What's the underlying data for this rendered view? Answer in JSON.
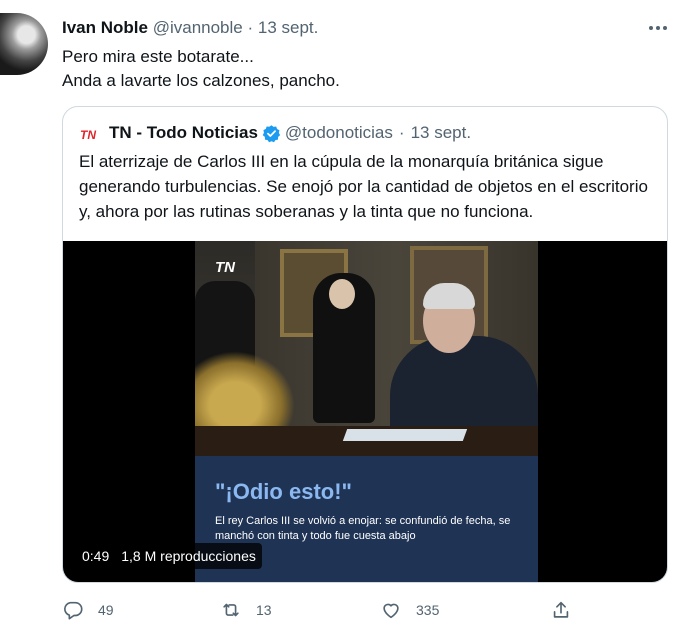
{
  "tweet": {
    "author_name": "Ivan Noble",
    "handle": "@ivannoble",
    "separator": "·",
    "time": "13 sept.",
    "more": "•••",
    "text_line1": "Pero mira este botarate...",
    "text_line2": "Anda a lavarte los calzones, pancho."
  },
  "quote": {
    "author_name": "TN - Todo Noticias",
    "handle": "@todonoticias",
    "separator": "·",
    "time": "13 sept.",
    "text": "El aterrizaje de Carlos III en la cúpula de la monarquía británica sigue generando turbulencias. Se enojó por la cantidad de objetos en el escritorio y, ahora por las rutinas soberanas y la tinta que no funciona.",
    "video": {
      "logo": "TN",
      "headline": "\"¡Odio esto!\"",
      "subtext": "El rey Carlos III se volvió a enojar: se confundió de fecha, se manchó con tinta y todo fue cuesta abajo",
      "duration": "0:49",
      "views": "1,8 M reproducciones"
    }
  },
  "actions": {
    "replies": "49",
    "retweets": "13",
    "likes": "335"
  },
  "colors": {
    "text": "#0f1419",
    "secondary": "#536471",
    "border": "#cfd9de",
    "verified": "#1d9bf0"
  }
}
